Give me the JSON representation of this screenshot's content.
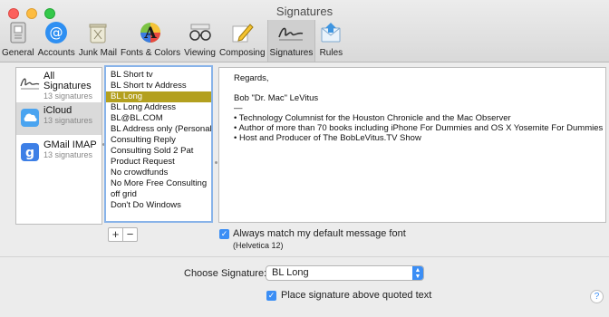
{
  "window": {
    "title": "Signatures"
  },
  "toolbar": {
    "items": [
      {
        "label": "General",
        "icon": "general-icon"
      },
      {
        "label": "Accounts",
        "icon": "at-sign-icon"
      },
      {
        "label": "Junk Mail",
        "icon": "junk-trash-icon"
      },
      {
        "label": "Fonts & Colors",
        "icon": "fonts-colors-icon"
      },
      {
        "label": "Viewing",
        "icon": "glasses-icon"
      },
      {
        "label": "Composing",
        "icon": "pencil-icon"
      },
      {
        "label": "Signatures",
        "icon": "signature-icon"
      },
      {
        "label": "Rules",
        "icon": "rules-icon"
      }
    ],
    "active": "Signatures"
  },
  "accounts": [
    {
      "name": "All Signatures",
      "sub": "13 signatures",
      "icon": "signature-icon"
    },
    {
      "name": "iCloud",
      "sub": "13 signatures",
      "icon": "icloud-icon"
    },
    {
      "name": "GMail IMAP",
      "sub": "13 signatures",
      "icon": "gmail-icon"
    }
  ],
  "selected_account": "iCloud",
  "signatures": [
    "BL Short tv",
    "BL Short tv Address",
    "BL Long",
    "BL Long Address",
    "BL@BL.COM",
    "BL Address only (Personal)",
    "Consulting Reply",
    "Consulting Sold 2 Pat",
    "Product Request",
    "No crowdfunds",
    "No More Free Consulting",
    "off grid",
    "Don't Do Windows"
  ],
  "selected_signature": "BL Long",
  "preview": {
    "greeting": "Regards,",
    "name": "Bob \"Dr. Mac\" LeVitus",
    "separator": "—",
    "bullets": [
      "• Technology Columnist for the Houston Chronicle and the Mac Observer",
      "• Author of more than 70 books including iPhone For Dummies and OS X Yosemite For Dummies",
      "• Host and Producer of The BobLeVitus.TV Show"
    ]
  },
  "buttons": {
    "add": "+",
    "remove": "−"
  },
  "match_font": {
    "label": "Always match my default message font",
    "font": "(Helvetica 12)",
    "checked": true
  },
  "choose": {
    "label": "Choose Signature:",
    "value": "BL Long"
  },
  "place_above": {
    "label": "Place signature above quoted text",
    "checked": true
  },
  "help": "?",
  "colors": {
    "selection": "#b3a01f",
    "accent": "#3b8ef5",
    "focus": "#88b3e9"
  }
}
